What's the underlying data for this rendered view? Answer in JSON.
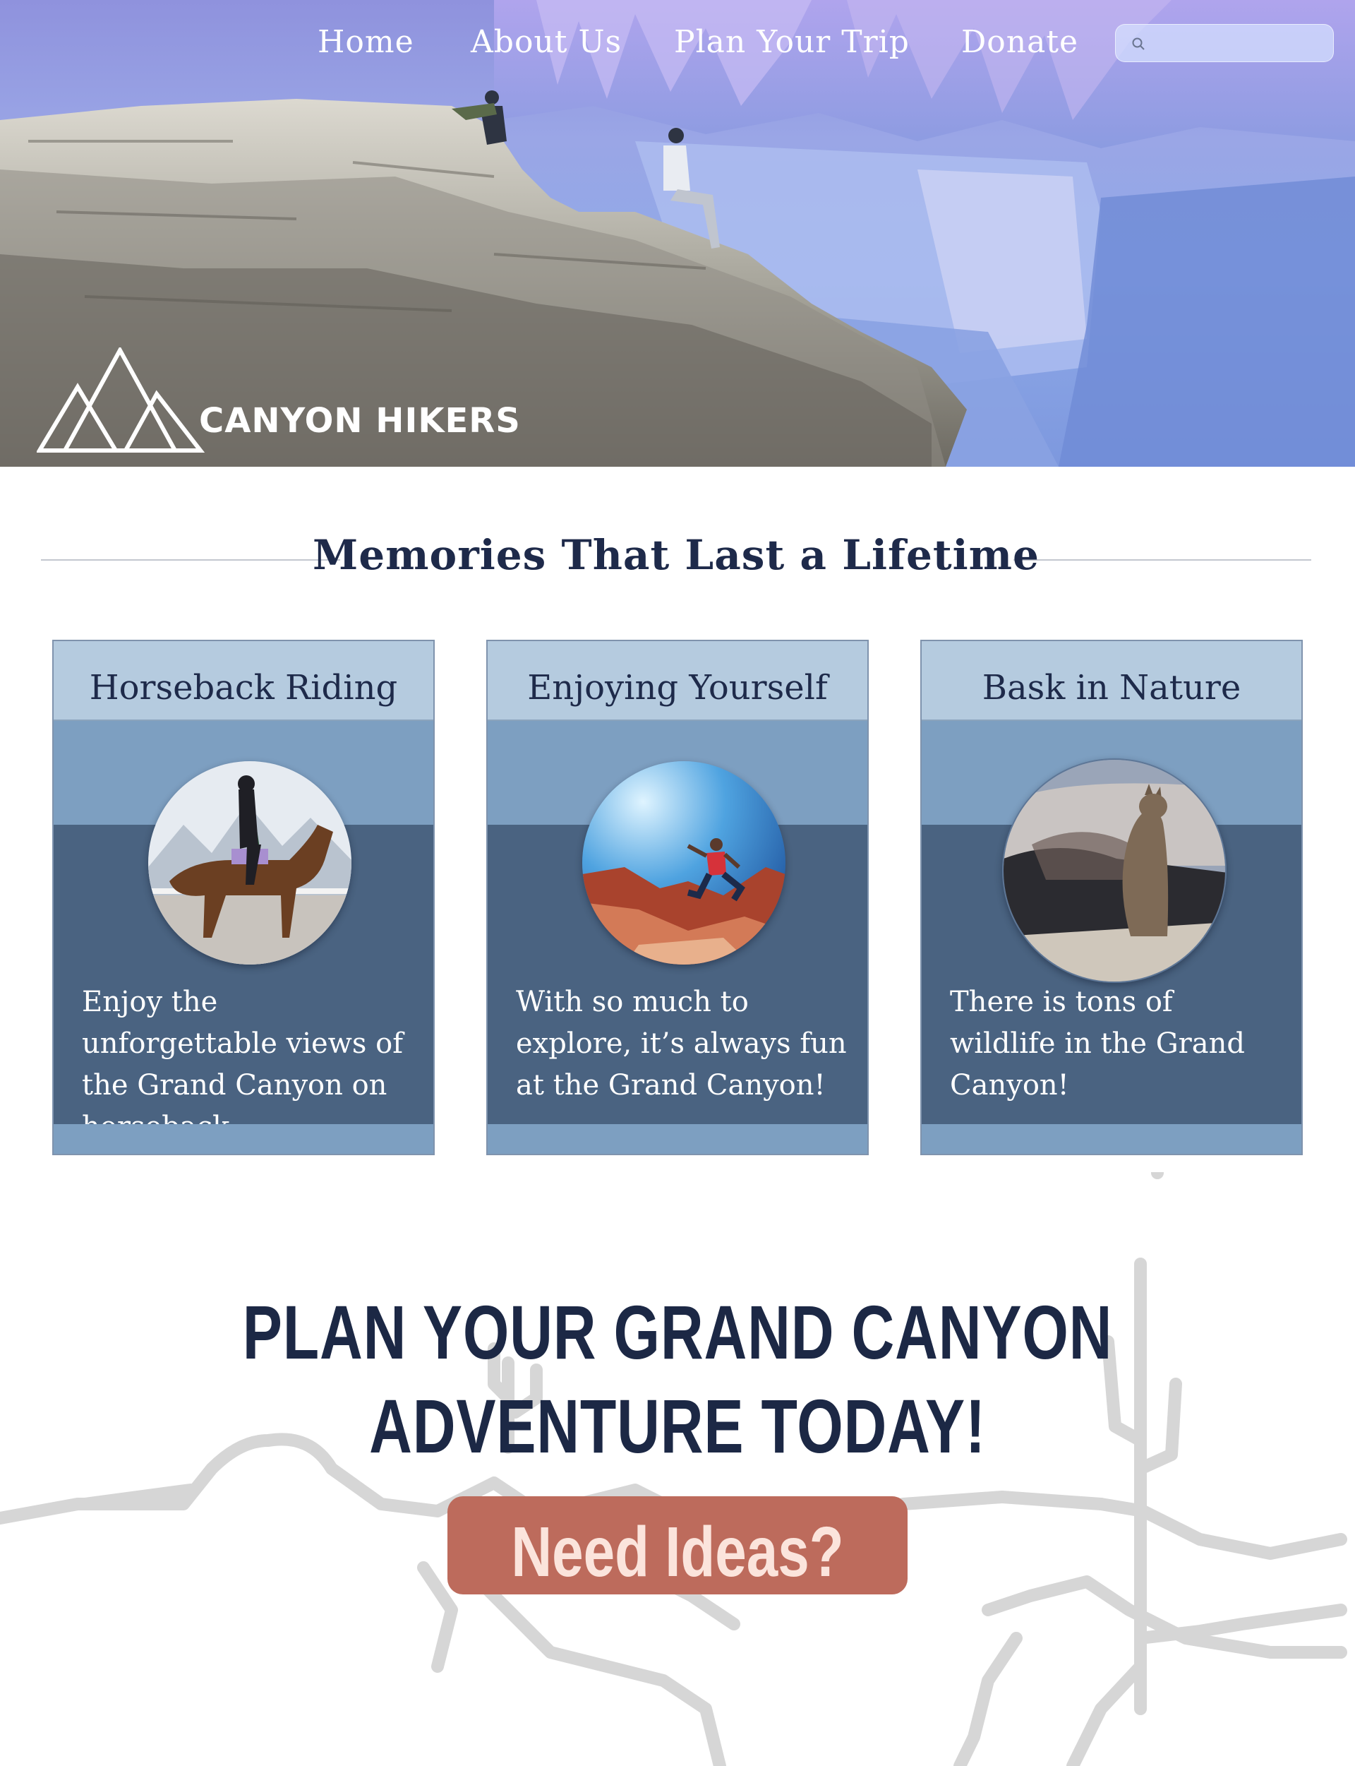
{
  "nav": {
    "items": [
      {
        "label": "Home"
      },
      {
        "label": "About Us"
      },
      {
        "label": "Plan Your Trip"
      },
      {
        "label": "Donate"
      }
    ],
    "search": {
      "value": "",
      "placeholder": ""
    }
  },
  "logo": {
    "text": "CANYON HIKERS"
  },
  "memories": {
    "title": "Memories That Last a Lifetime",
    "cards": [
      {
        "title": "Horseback Riding",
        "text": "Enjoy the unforgettable views of the Grand Canyon on horseback"
      },
      {
        "title": "Enjoying Yourself",
        "text": "With so much to explore, it’s always fun at the Grand Canyon!"
      },
      {
        "title": "Bask in Nature",
        "text": "There is tons of wildlife in the Grand Canyon!"
      }
    ]
  },
  "cta": {
    "heading": "PLAN YOUR GRAND CANYON ADVENTURE TODAY!",
    "button_label": "Need Ideas?"
  },
  "colors": {
    "navy": "#1c2845",
    "card_header": "#b5cbdf",
    "card_band": "#7d9fc1",
    "card_body": "#4a6381",
    "button": "#bd6b5c",
    "button_text": "#fbe4dc"
  }
}
